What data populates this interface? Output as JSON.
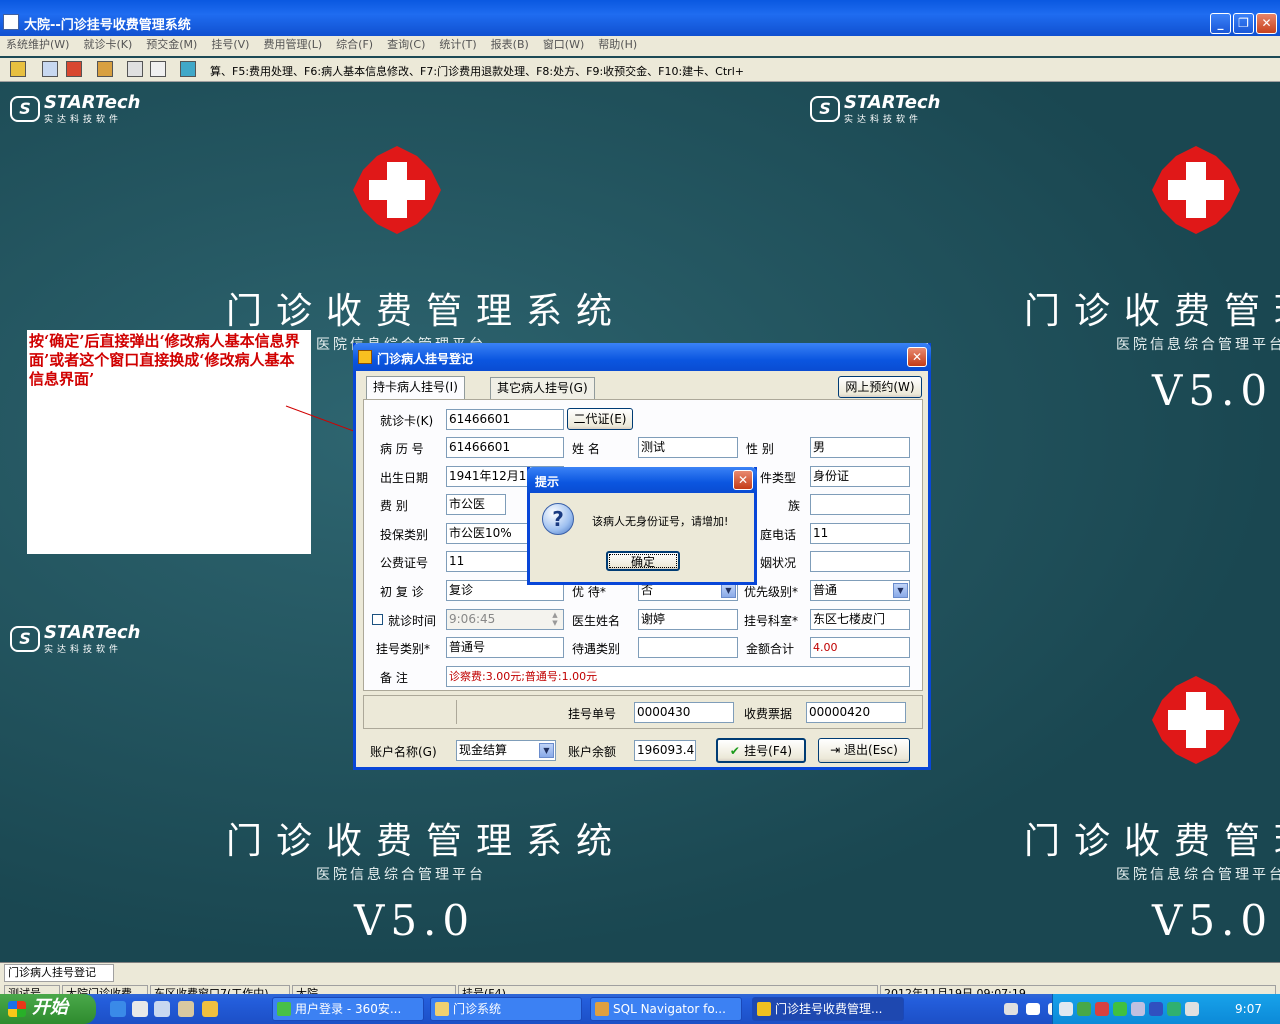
{
  "window": {
    "title": "大院--门诊挂号收费管理系统"
  },
  "menu": [
    "系统维护(W)",
    "就诊卡(K)",
    "预交金(M)",
    "挂号(V)",
    "费用管理(L)",
    "综合(F)",
    "查询(C)",
    "统计(T)",
    "报表(B)",
    "窗口(W)",
    "帮助(H)"
  ],
  "toolbar": {
    "hint": "算、F5:费用处理、F6:病人基本信息修改、F7:门诊费用退款处理、F8:处方、F9:收预交金、F10:建卡、Ctrl+"
  },
  "desktop": {
    "logo_text": "STARTech",
    "logo_sub": "实达科技软件",
    "title": "门诊收费管理系统",
    "subtitle": "医院信息综合管理平台",
    "version": "V5.0"
  },
  "note": "按‘确定’后直接弹出‘修改病人基本信息界面’或者这个窗口直接换成‘修改病人基本信息界面’",
  "dialog": {
    "title": "门诊病人挂号登记",
    "tab_card": "持卡病人挂号(I)",
    "tab_other": "其它病人挂号(G)",
    "online_btn": "网上预约(W)",
    "labels": {
      "card": "就诊卡(K)",
      "id2": "二代证(E)",
      "record": "病 历 号",
      "name": "姓  名",
      "sex": "性  别",
      "birth": "出生日期",
      "idtype": "件类型",
      "fee": "费  别",
      "nation": "族",
      "insure": "投保类别",
      "phone": "庭电话",
      "pubno": "公费证号",
      "marital": "姻状况",
      "visit": "初 复 诊",
      "favor": "优  待*",
      "priority": "优先级别*",
      "vtime": "就诊时间",
      "doctor": "医生姓名",
      "dept": "挂号科室*",
      "regtype": "挂号类别*",
      "treat": "待遇类别",
      "total": "金额合计",
      "remark": "备  注",
      "regno": "挂号单号",
      "receipt": "收费票据",
      "account": "账户名称(G)",
      "balance": "账户余额"
    },
    "values": {
      "card": "61466601",
      "record": "61466601",
      "name": "测试",
      "sex": "男",
      "birth": "1941年12月1",
      "idtype": "身份证",
      "fee": "市公医",
      "nation": "",
      "insure": "市公医10%",
      "phone": "11",
      "pubno": "11",
      "marital": "",
      "visit": "复诊",
      "favor": "否",
      "priority": "普通",
      "vtime": "9:06:45",
      "doctor": "谢婷",
      "dept": "东区七楼皮门",
      "regtype": "普通号",
      "treat": "",
      "total": "4.00",
      "remark": "诊察费:3.00元;普通号:1.00元",
      "regno": "0000430",
      "receipt": "00000420",
      "account": "现金结算",
      "balance": "196093.4"
    },
    "register_btn": "挂号(F4)",
    "exit_btn": "退出(Esc)"
  },
  "msgbox": {
    "title": "提示",
    "message": "该病人无身份证号，请增加!",
    "ok": "确定"
  },
  "statusbar": {
    "panel1": "门诊病人挂号登记",
    "panel2": "测试号",
    "panel3": "大院门诊收费",
    "panel4": "东区收费窗口7(工作中)",
    "panel5": "大院",
    "panel6": "挂号(F4)",
    "panel7": "2012年11月19日 09:07:19"
  },
  "taskbar": {
    "start": "开始",
    "tasks": [
      "用户登录 - 360安...",
      "门诊系统",
      "SQL Navigator fo...",
      "门诊挂号收费管理..."
    ],
    "clock": "9:07"
  }
}
